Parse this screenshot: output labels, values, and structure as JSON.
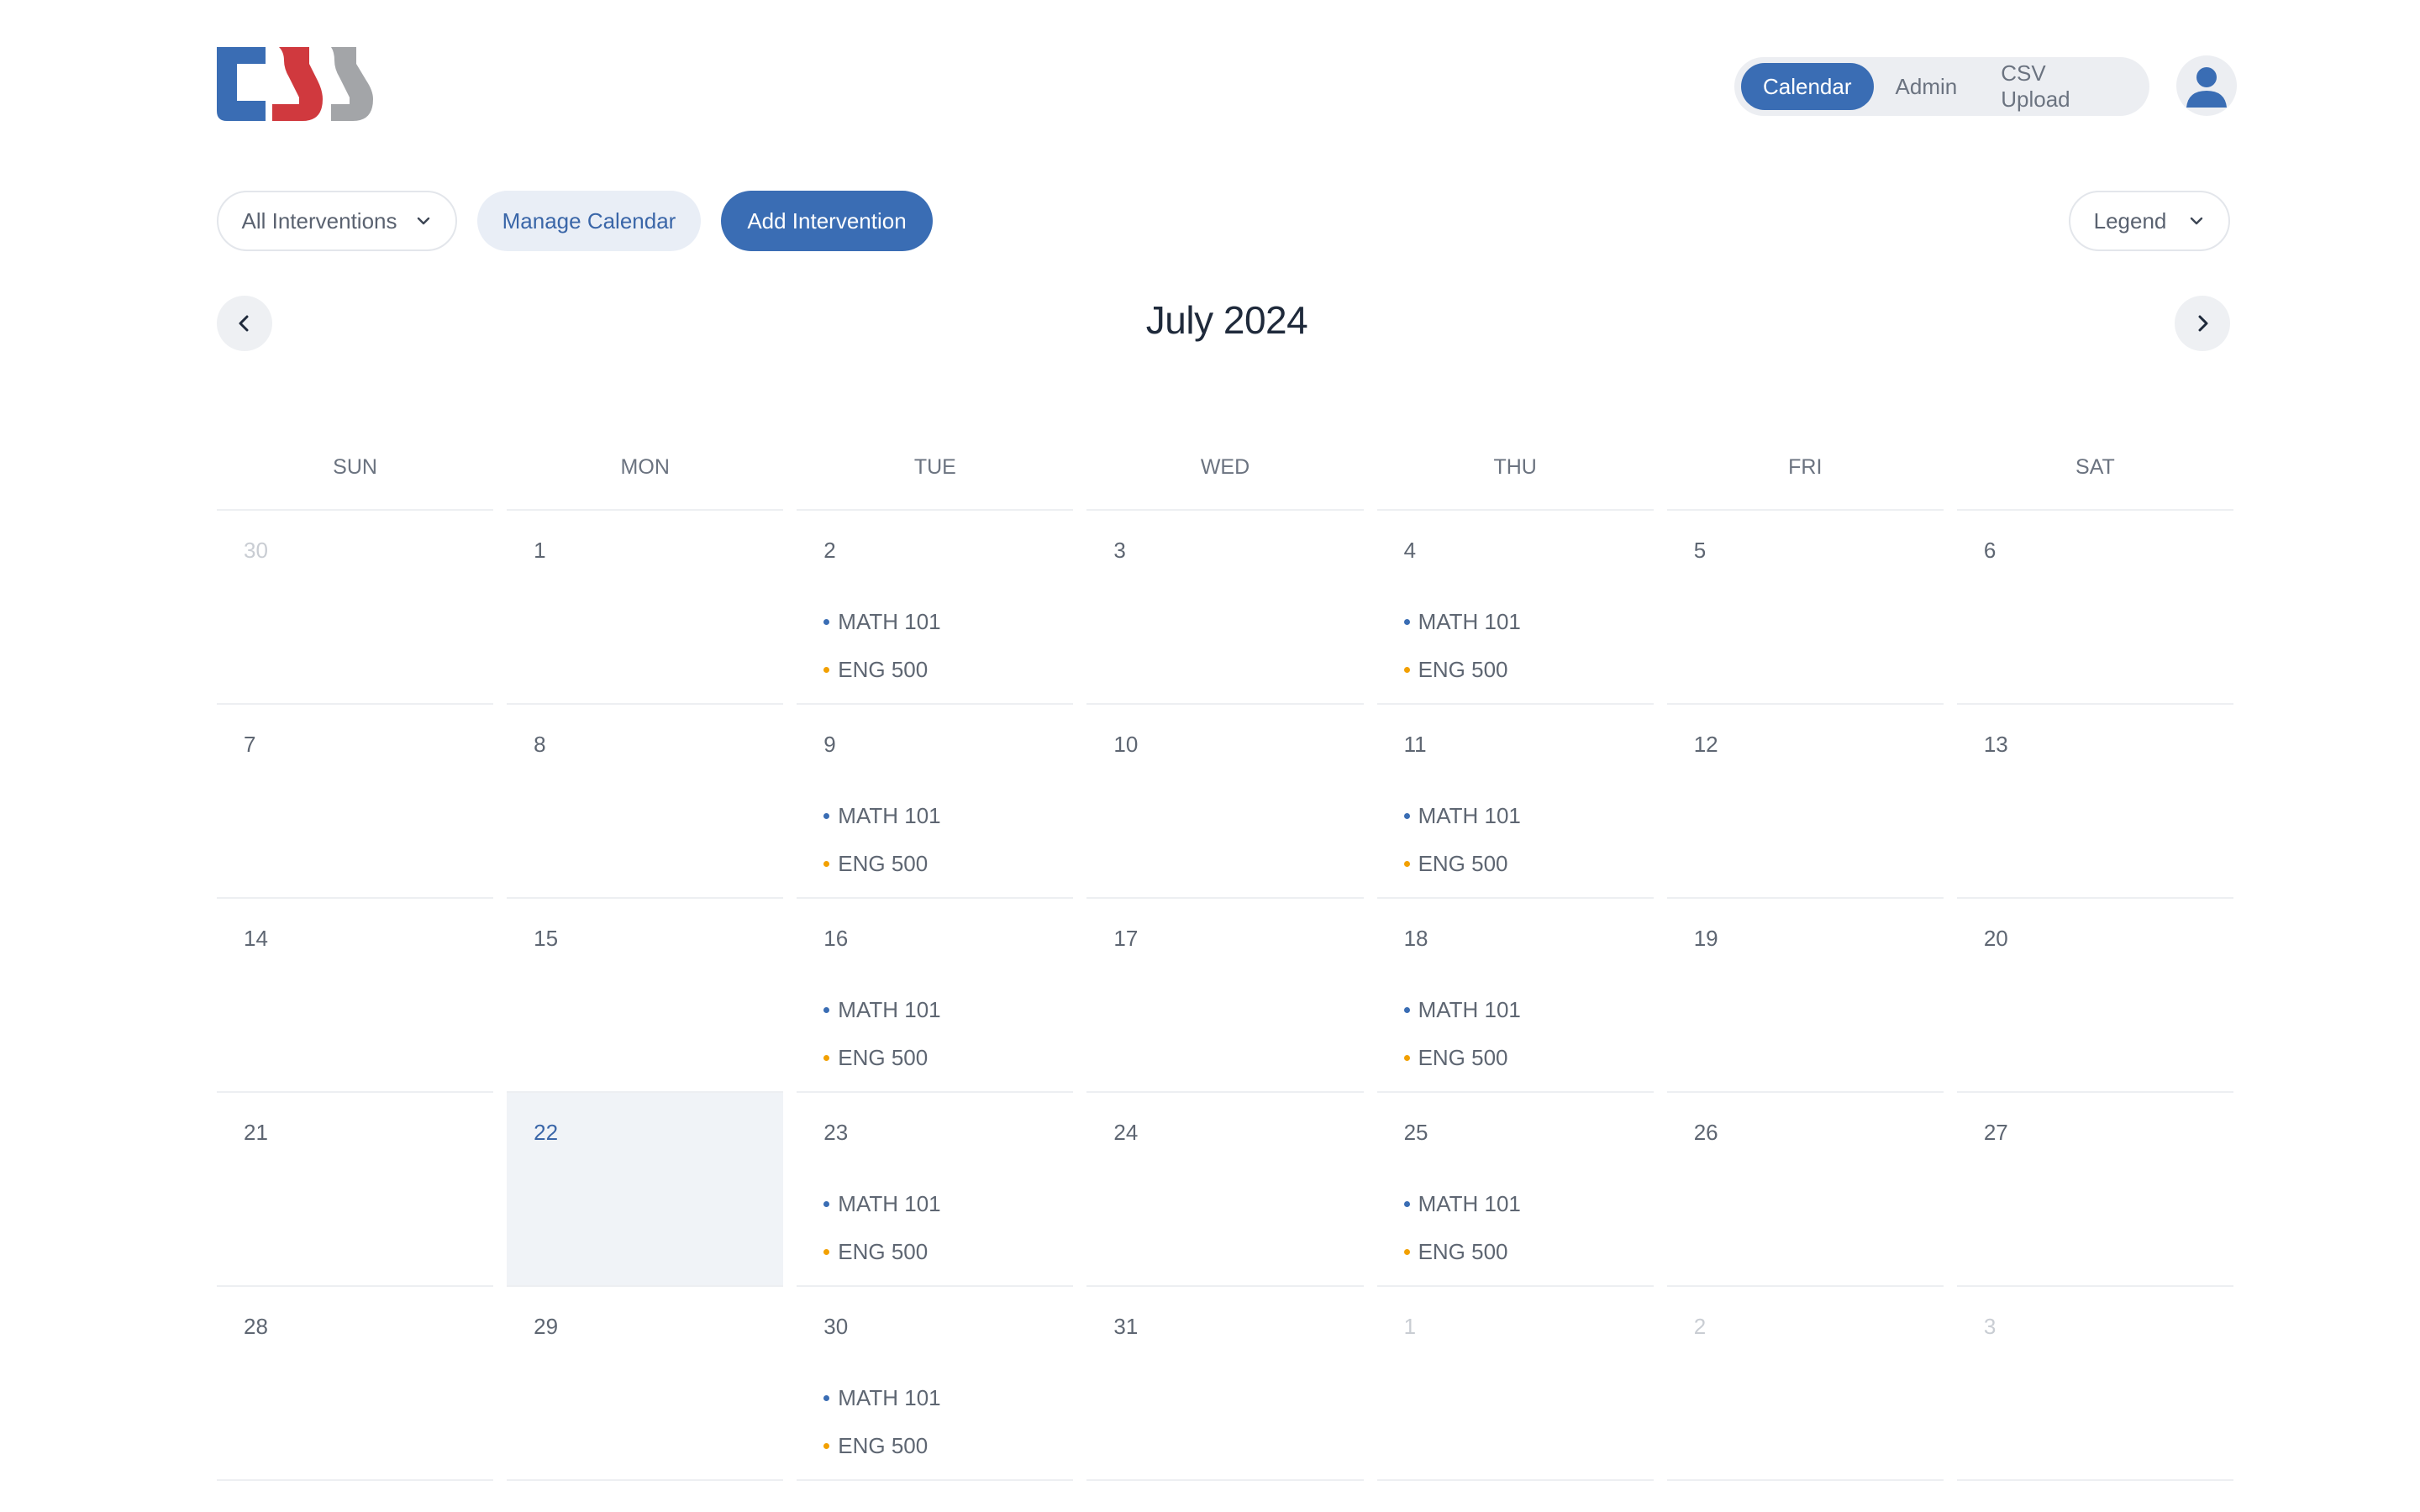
{
  "nav": {
    "tabs": [
      {
        "label": "Calendar",
        "active": true
      },
      {
        "label": "Admin",
        "active": false
      },
      {
        "label": "CSV Upload",
        "active": false
      }
    ]
  },
  "logo": {
    "text": "tss",
    "colors": [
      "#3a6db4",
      "#d0393e",
      "#a3a5a8"
    ]
  },
  "toolbar": {
    "filter_label": "All Interventions",
    "manage_label": "Manage Calendar",
    "add_label": "Add Intervention",
    "legend_label": "Legend"
  },
  "month_title": "July 2024",
  "weekdays": [
    "SUN",
    "MON",
    "TUE",
    "WED",
    "THU",
    "FRI",
    "SAT"
  ],
  "event_colors": {
    "MATH 101": "#3a6db4",
    "ENG 500": "#f2a000"
  },
  "weeks": [
    [
      {
        "day": "30",
        "muted": true,
        "events": []
      },
      {
        "day": "1",
        "events": []
      },
      {
        "day": "2",
        "events": [
          "MATH 101",
          "ENG 500"
        ]
      },
      {
        "day": "3",
        "events": []
      },
      {
        "day": "4",
        "events": [
          "MATH 101",
          "ENG 500"
        ]
      },
      {
        "day": "5",
        "events": []
      },
      {
        "day": "6",
        "events": []
      }
    ],
    [
      {
        "day": "7",
        "events": []
      },
      {
        "day": "8",
        "events": []
      },
      {
        "day": "9",
        "events": [
          "MATH 101",
          "ENG 500"
        ]
      },
      {
        "day": "10",
        "events": []
      },
      {
        "day": "11",
        "events": [
          "MATH 101",
          "ENG 500"
        ]
      },
      {
        "day": "12",
        "events": []
      },
      {
        "day": "13",
        "events": []
      }
    ],
    [
      {
        "day": "14",
        "events": []
      },
      {
        "day": "15",
        "events": []
      },
      {
        "day": "16",
        "events": [
          "MATH 101",
          "ENG 500"
        ]
      },
      {
        "day": "17",
        "events": []
      },
      {
        "day": "18",
        "events": [
          "MATH 101",
          "ENG 500"
        ]
      },
      {
        "day": "19",
        "events": []
      },
      {
        "day": "20",
        "events": []
      }
    ],
    [
      {
        "day": "21",
        "events": []
      },
      {
        "day": "22",
        "today": true,
        "events": []
      },
      {
        "day": "23",
        "events": [
          "MATH 101",
          "ENG 500"
        ]
      },
      {
        "day": "24",
        "events": []
      },
      {
        "day": "25",
        "events": [
          "MATH 101",
          "ENG 500"
        ]
      },
      {
        "day": "26",
        "events": []
      },
      {
        "day": "27",
        "events": []
      }
    ],
    [
      {
        "day": "28",
        "events": []
      },
      {
        "day": "29",
        "events": []
      },
      {
        "day": "30",
        "events": [
          "MATH 101",
          "ENG 500"
        ]
      },
      {
        "day": "31",
        "events": []
      },
      {
        "day": "1",
        "muted": true,
        "events": []
      },
      {
        "day": "2",
        "muted": true,
        "events": []
      },
      {
        "day": "3",
        "muted": true,
        "events": []
      }
    ]
  ]
}
